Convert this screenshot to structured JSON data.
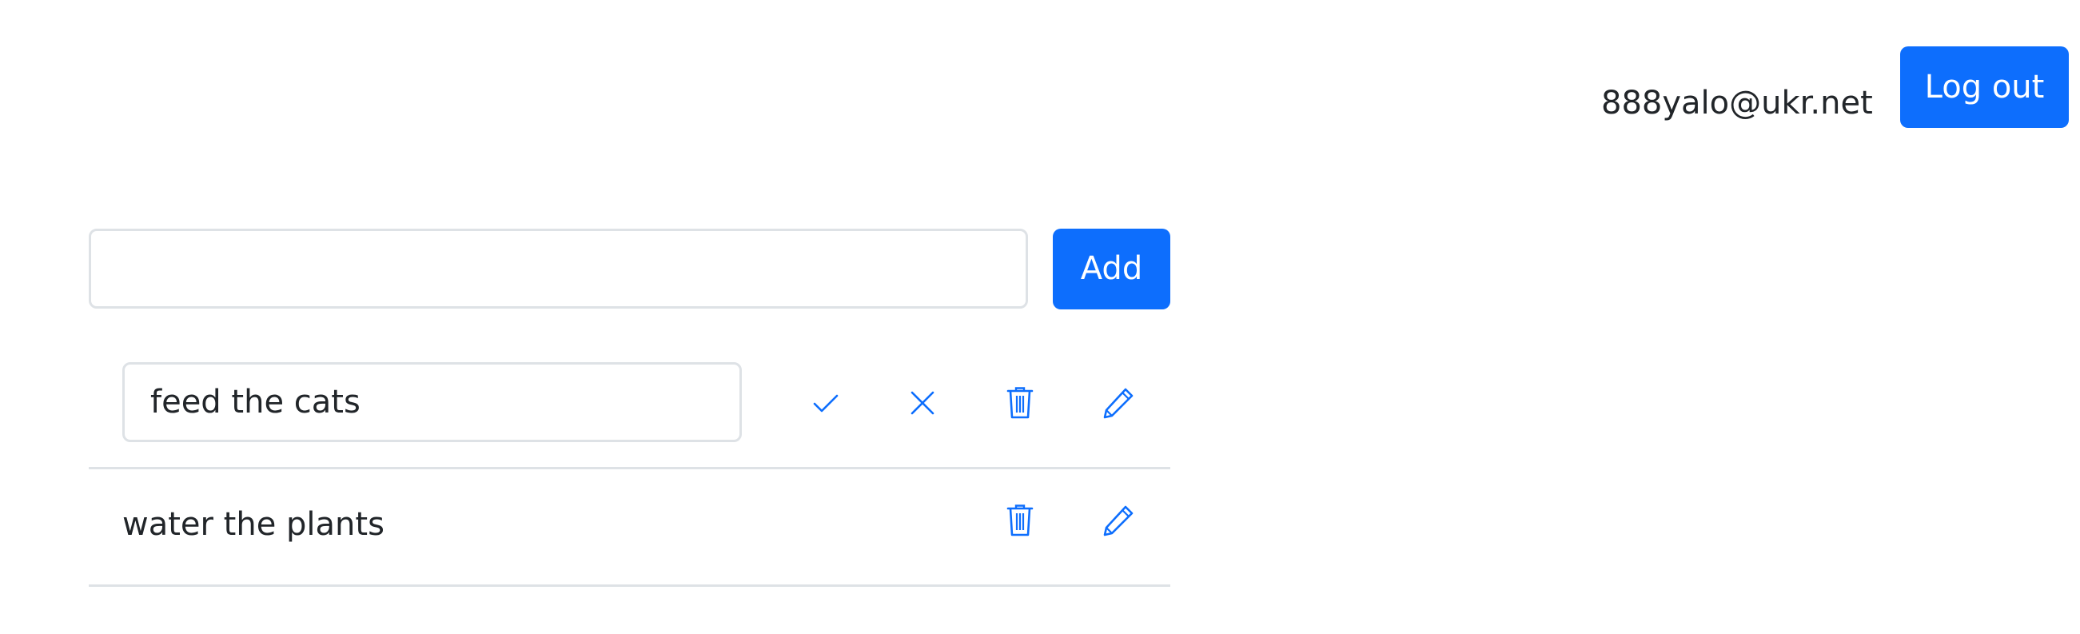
{
  "header": {
    "user_email": "888yalo@ukr.net",
    "logout_label": "Log out"
  },
  "add_form": {
    "input_value": "",
    "add_label": "Add"
  },
  "todos": [
    {
      "text": "feed the cats",
      "editing": true,
      "actions": [
        "check-icon",
        "close-icon",
        "trash-icon",
        "pencil-icon"
      ]
    },
    {
      "text": "water the plants",
      "editing": false,
      "actions": [
        "trash-icon",
        "pencil-icon"
      ]
    }
  ],
  "colors": {
    "primary": "#0d6efd",
    "border": "#dee2e6",
    "text": "#212529"
  }
}
